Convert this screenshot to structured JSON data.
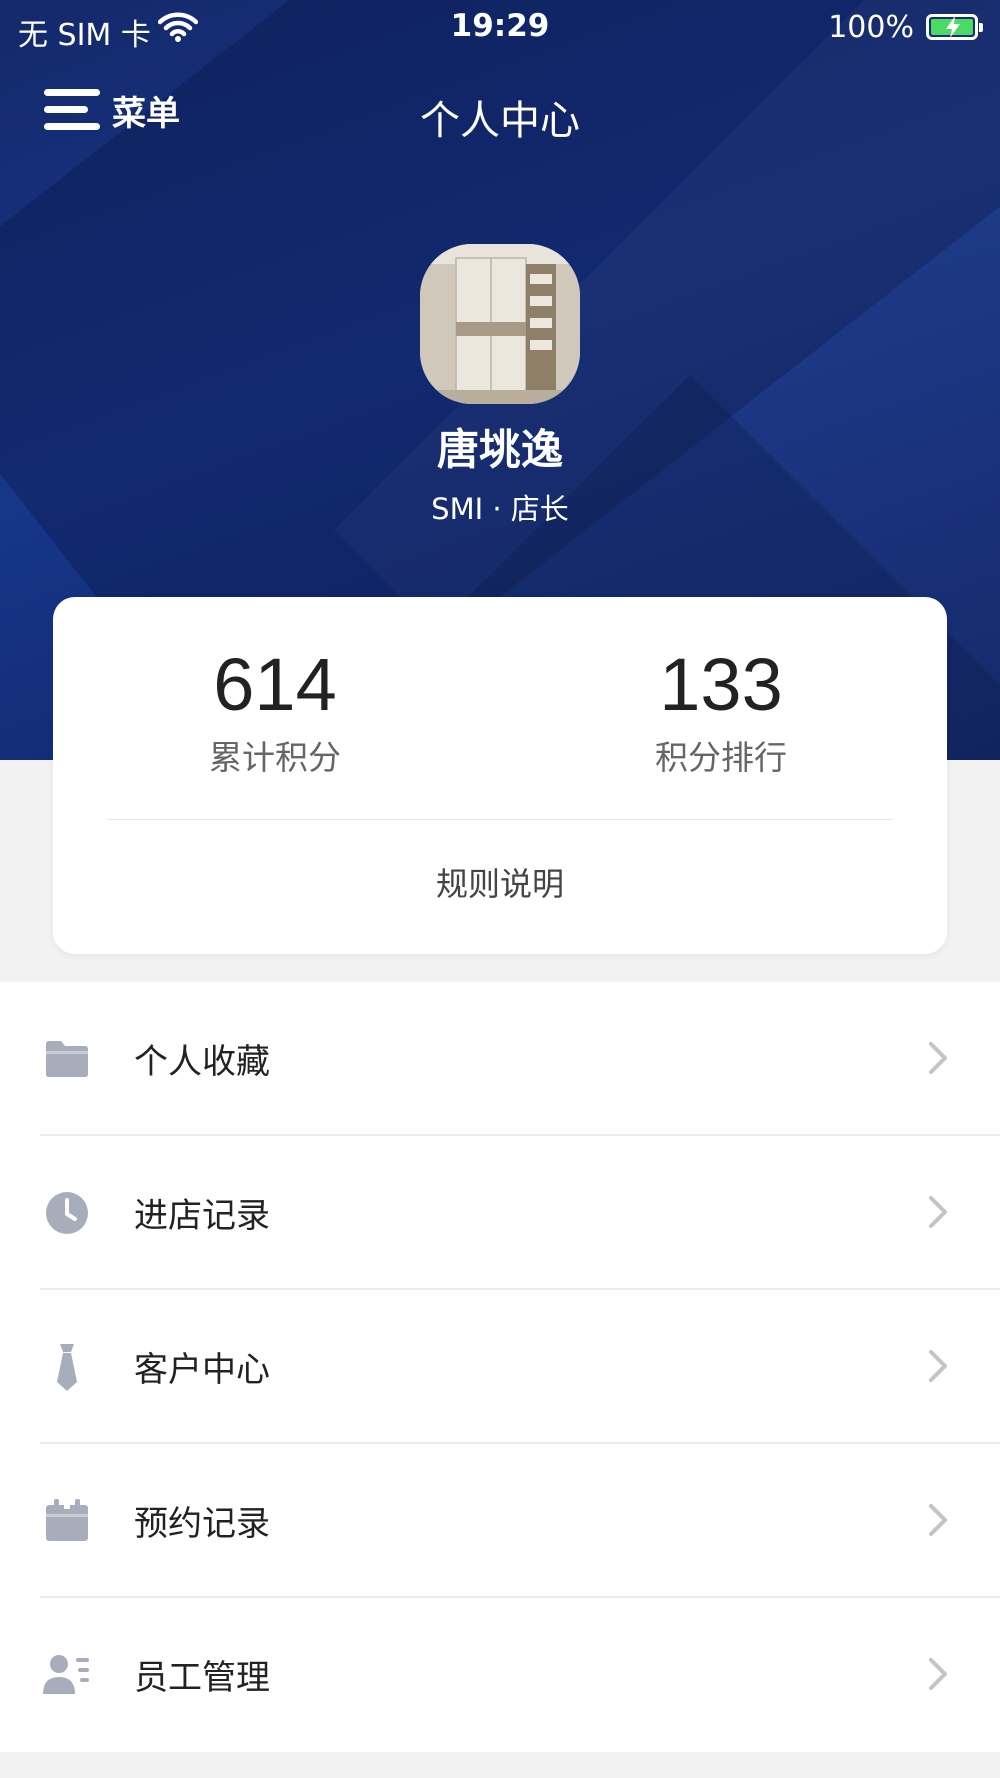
{
  "statusbar": {
    "carrier": "无 SIM 卡",
    "time": "19:29",
    "battery": "100%"
  },
  "nav": {
    "menu_label": "菜单",
    "title": "个人中心"
  },
  "profile": {
    "name": "唐垗逸",
    "role": "SMI · 店长"
  },
  "stats": {
    "points_value": "614",
    "points_label": "累计积分",
    "rank_value": "133",
    "rank_label": "积分排行",
    "rules_label": "规则说明"
  },
  "menu": {
    "items": [
      {
        "label": "个人收藏",
        "icon": "folder-icon"
      },
      {
        "label": "进店记录",
        "icon": "clock-icon"
      },
      {
        "label": "客户中心",
        "icon": "tie-icon"
      },
      {
        "label": "预约记录",
        "icon": "calendar-icon"
      },
      {
        "label": "员工管理",
        "icon": "staff-icon"
      }
    ]
  },
  "colors": {
    "hero_blue": "#173688",
    "icon_gray": "#a7adba",
    "battery_green": "#4cd964"
  }
}
